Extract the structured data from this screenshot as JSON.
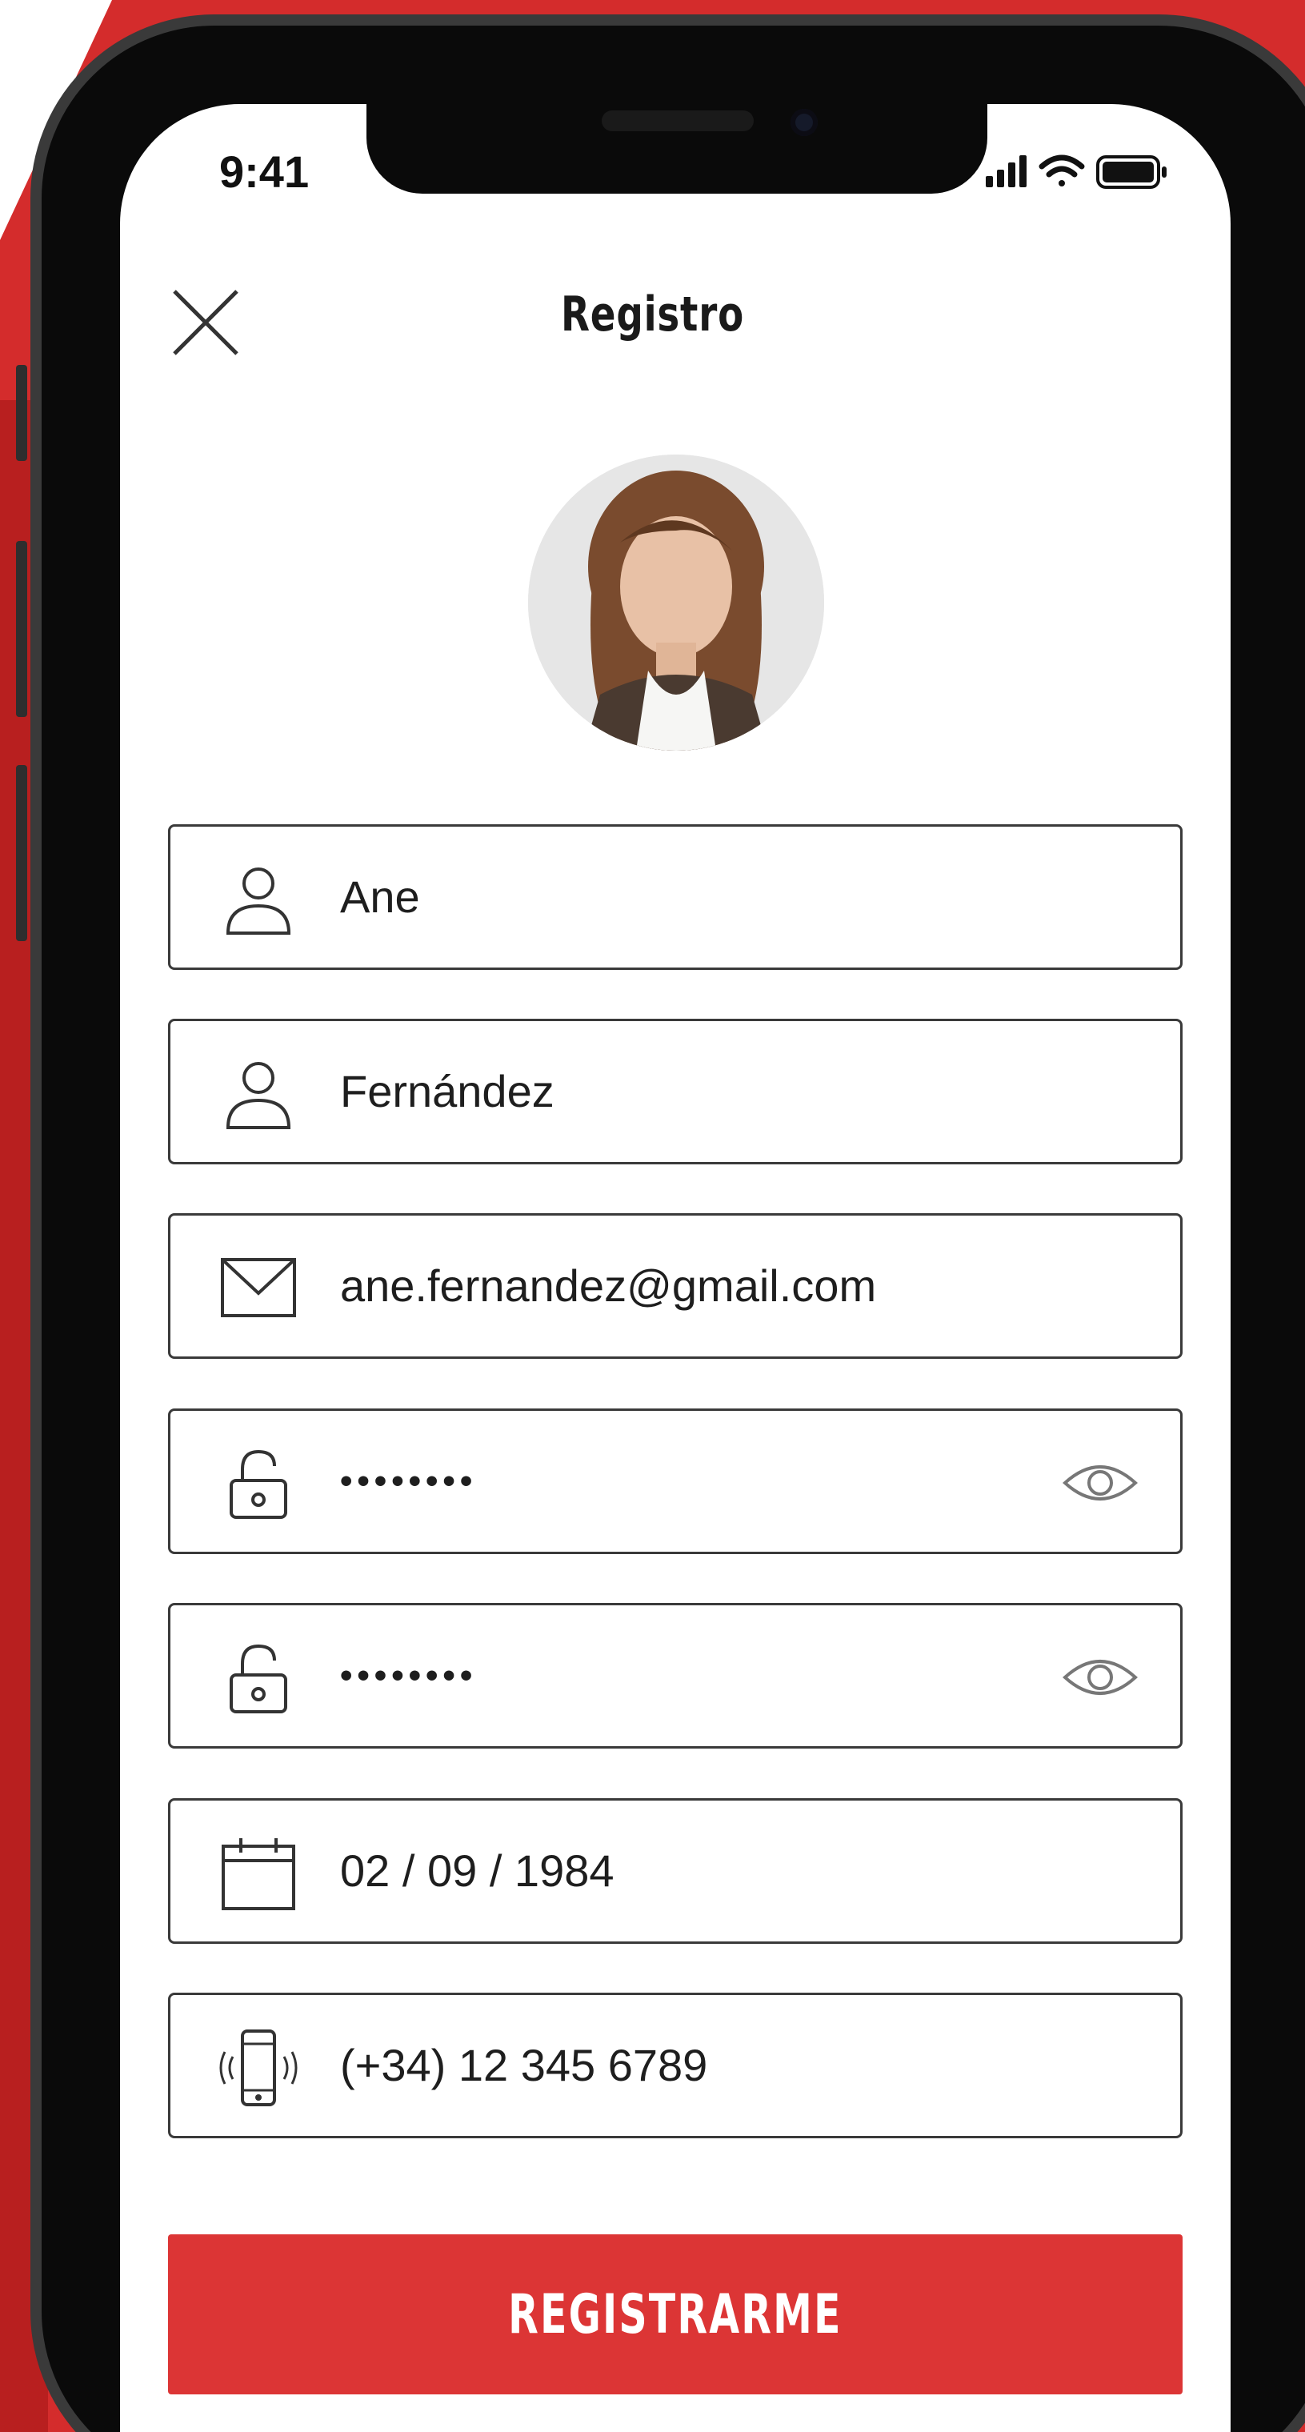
{
  "status_bar": {
    "time": "9:41"
  },
  "header": {
    "title": "Registro"
  },
  "form": {
    "first_name": "Ane",
    "last_name": "Fernández",
    "email": "ane.fernandez@gmail.com",
    "password": "••••••••",
    "password_confirm": "••••••••",
    "birth_date": "02 / 09 / 1984",
    "phone": "(+34) 12 345 6789"
  },
  "submit": {
    "label": "REGISTRARME"
  },
  "colors": {
    "brand_red": "#dc3535",
    "backdrop_red": "#d42c2c"
  },
  "icons": [
    "close-icon",
    "user-icon",
    "mail-icon",
    "lock-icon",
    "eye-icon",
    "calendar-icon",
    "phone-icon",
    "signal-icon",
    "wifi-icon",
    "battery-icon"
  ]
}
